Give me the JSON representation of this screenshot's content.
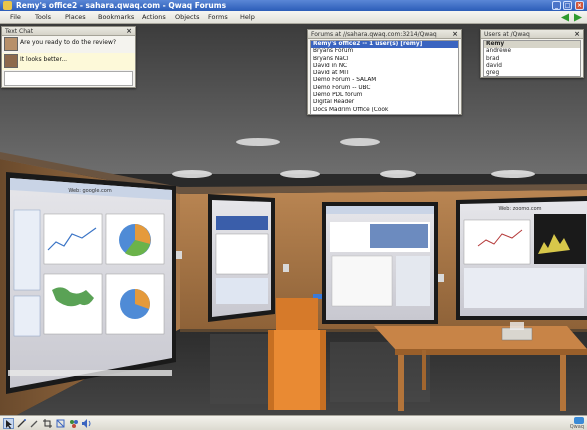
{
  "window": {
    "title": "Remy's office2 - sahara.qwaq.com - Qwaq Forums"
  },
  "menu": [
    "File",
    "Tools",
    "Places",
    "Bookmarks",
    "Actions",
    "Objects",
    "Forms",
    "Help"
  ],
  "text_chat": {
    "title": "Text Chat",
    "messages": [
      {
        "text": "Are you ready to do the review?"
      },
      {
        "text": "It looks better..."
      }
    ]
  },
  "forums": {
    "title": "Forums at //sahara.qwaq.com:3214/Qwaq",
    "items": [
      "Remy's office2 -- 1 user(s) [remy]",
      "Bryans Forum",
      "Bryans NaCl",
      "David in NC",
      "David at MIT",
      "Demo Forum - SALAM",
      "Demo Forum -- UBC",
      "Demo PDL forum",
      "Digital Reader",
      "Docs Madrim Office (Cook"
    ]
  },
  "users": {
    "title": "Users at /Qwaq",
    "items": [
      "Remy",
      "andrewe",
      "brad",
      "david",
      "greg"
    ]
  },
  "scene": {
    "screen1_title": "Web: google.com",
    "screen4_title": "Web: zoomo.com"
  },
  "status_badge": "Qwaq",
  "colors": {
    "title_bar": "#2c5db8",
    "selection": "#3a64c0",
    "nav_arrows": "#2e9a2e"
  }
}
